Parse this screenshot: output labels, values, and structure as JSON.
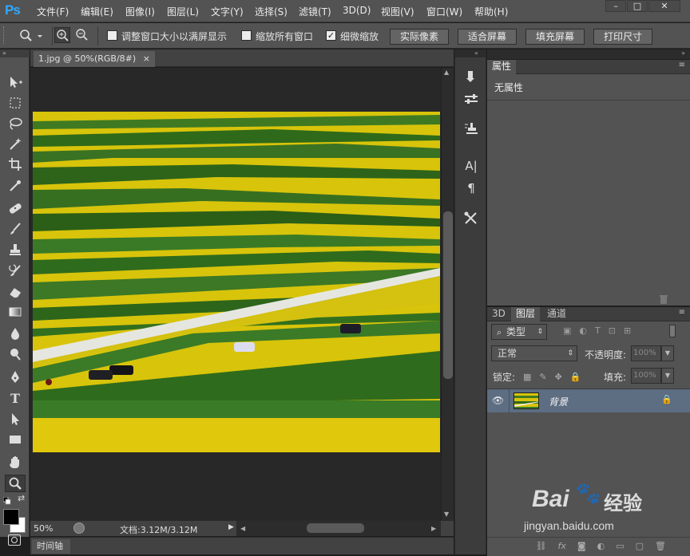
{
  "app": {
    "logo": "Ps"
  },
  "menu": [
    "文件(F)",
    "编辑(E)",
    "图像(I)",
    "图层(L)",
    "文字(Y)",
    "选择(S)",
    "滤镜(T)",
    "3D(D)",
    "视图(V)",
    "窗口(W)",
    "帮助(H)"
  ],
  "window_controls": {
    "minimize": "–",
    "restore": "□",
    "close": "✕"
  },
  "options": {
    "resize_windows_label": "调整窗口大小以满屏显示",
    "zoom_all_label": "缩放所有窗口",
    "scrubby_zoom_label": "细微缩放",
    "resize_windows_checked": false,
    "zoom_all_checked": false,
    "scrubby_zoom_checked": true,
    "actual_pixels": "实际像素",
    "fit_screen": "适合屏幕",
    "fill_screen": "填充屏幕",
    "print_size": "打印尺寸"
  },
  "document": {
    "tab_title": "1.jpg @ 50%(RGB/8#)",
    "tab_close": "×",
    "zoom": "50%",
    "doc_info": "文档:3.12M/3.12M"
  },
  "timeline": {
    "label": "时间轴"
  },
  "tools": [
    "move-tool-icon",
    "marquee-tool-icon",
    "lasso-tool-icon",
    "magic-wand-tool-icon",
    "crop-tool-icon",
    "eyedropper-tool-icon",
    "healing-brush-tool-icon",
    "brush-tool-icon",
    "clone-stamp-tool-icon",
    "history-brush-tool-icon",
    "eraser-tool-icon",
    "gradient-tool-icon",
    "blur-tool-icon",
    "dodge-tool-icon",
    "pen-tool-icon",
    "type-tool-icon",
    "path-selection-tool-icon",
    "rectangle-tool-icon",
    "hand-tool-icon",
    "zoom-tool-icon"
  ],
  "colors": {
    "foreground": "#000000",
    "background": "#ffffff",
    "accent": "#31a8ff",
    "selected_layer": "#5d6d82"
  },
  "properties_panel": {
    "tab": "属性",
    "content": "无属性"
  },
  "layers_panel": {
    "tabs": [
      "3D",
      "图层",
      "通道"
    ],
    "active_tab": "图层",
    "filter_kind": "类型",
    "blend_mode": "正常",
    "opacity_label": "不透明度:",
    "opacity_value": "100%",
    "lock_label": "锁定:",
    "fill_label": "填充:",
    "fill_value": "100%",
    "layers": [
      {
        "name": "背景",
        "visible": true,
        "locked": true,
        "selected": true
      }
    ],
    "bottom_actions": [
      "link-layers-icon",
      "fx-icon",
      "add-mask-icon",
      "adjustment-layer-icon",
      "new-group-icon",
      "new-layer-icon",
      "delete-layer-icon"
    ]
  },
  "watermark": {
    "brand": "Bai",
    "brand_cn": "经验",
    "url": "jingyan.baidu.com"
  }
}
